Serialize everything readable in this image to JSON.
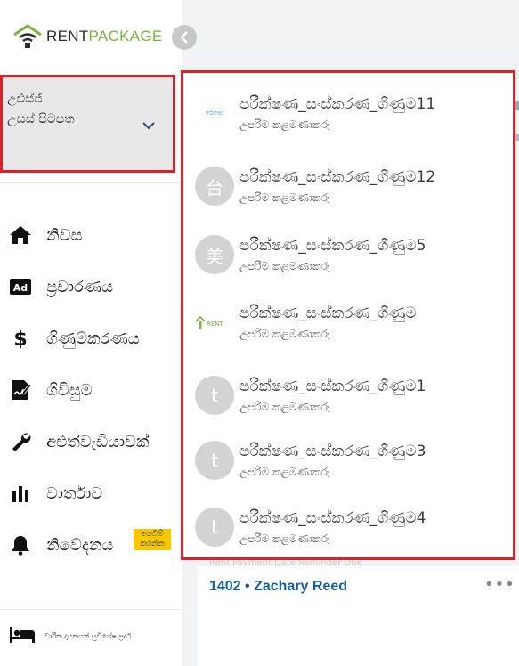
{
  "brand": {
    "rent": "RENT",
    "package": "PACKAGE"
  },
  "colors": {
    "accent_red": "#d8232a",
    "brand_green": "#7cb342",
    "link_blue": "#1a5ba6",
    "badge_yellow": "#f7c800"
  },
  "sidebar": {
    "collapse_icon": "chevron-left-icon",
    "account": {
      "name": "උඑස්ජ්",
      "role": "උසස් පිටපත",
      "icon": "chevron-down-icon"
    },
    "items": [
      {
        "label": "නිවස",
        "icon": "home-icon"
      },
      {
        "label": "ප්‍රචාරණය",
        "icon": "ad-icon"
      },
      {
        "label": "ගිණුම්කරණය",
        "icon": "dollar-icon"
      },
      {
        "label": "ගිවිසුම",
        "icon": "contract-icon"
      },
      {
        "label": "අළුත්වැඩියාවක්",
        "icon": "wrench-icon"
      },
      {
        "label": "වාර්තාව",
        "icon": "bar-chart-icon"
      },
      {
        "label": "නිවේදනය",
        "icon": "bell-icon",
        "badge": "ගෙවීම් කරන්න"
      }
    ],
    "footer": {
      "text": "වාරික දායකයන් සුවිශේෂ ප්‍රදර්",
      "icon": "bed-icon"
    }
  },
  "dropdown": {
    "items": [
      {
        "name": "පරීක්ෂණ_සංස්කරණ_ගිණුම11",
        "role": "උපරිම කළමණාකරු",
        "avatar": "",
        "avatar_type": "logo-small-text",
        "avatar_logo_text": "රෙසෝ"
      },
      {
        "name": "පරීක්ෂණ_සංස්කරණ_ගිණුම12",
        "role": "උපරිම කළමණාකරු",
        "avatar": "台",
        "avatar_type": "letter"
      },
      {
        "name": "පරීක්ෂණ_සංස්කරණ_ගිණුම5",
        "role": "උපරිම කළමණාකරු",
        "avatar": "美",
        "avatar_type": "letter"
      },
      {
        "name": "පරීක්ෂණ_සංස්කරණ_ගිණුම",
        "role": "උපරිම කළමණාකරු",
        "avatar": "",
        "avatar_type": "logo-rentpackage"
      },
      {
        "name": "පරීක්ෂණ_සංස්කරණ_ගිණුම1",
        "role": "උපරිම කළමණාකරු",
        "avatar": "t",
        "avatar_type": "letter"
      },
      {
        "name": "පරීක්ෂණ_සංස්කරණ_ගිණුම3",
        "role": "උපරිම කළමණාකරු",
        "avatar": "t",
        "avatar_type": "letter"
      },
      {
        "name": "පරීක්ෂණ_සංස්කරණ_ගිණුම4",
        "role": "උපරිම කළමණාකරු",
        "avatar": "t",
        "avatar_type": "letter"
      }
    ]
  },
  "main": {
    "card_peek_label": "Rent Payment Date Reminder Due",
    "card": {
      "title": "1402 • Zachary Reed",
      "more_icon": "more-horizontal-icon",
      "more": "•••"
    }
  }
}
